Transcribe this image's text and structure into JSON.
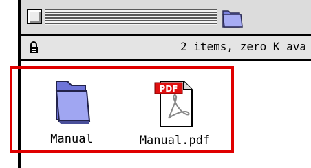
{
  "window": {
    "status_text": "2 items, zero K ava",
    "title_icon": "folder-icon"
  },
  "items": [
    {
      "label": "Manual",
      "icon": "folder-icon"
    },
    {
      "label": "Manual.pdf",
      "icon": "pdf-document-icon",
      "badge": "PDF"
    }
  ],
  "colors": {
    "highlight": "#e00000",
    "folder": "#9aa0f0",
    "pdf_badge": "#e01010"
  }
}
